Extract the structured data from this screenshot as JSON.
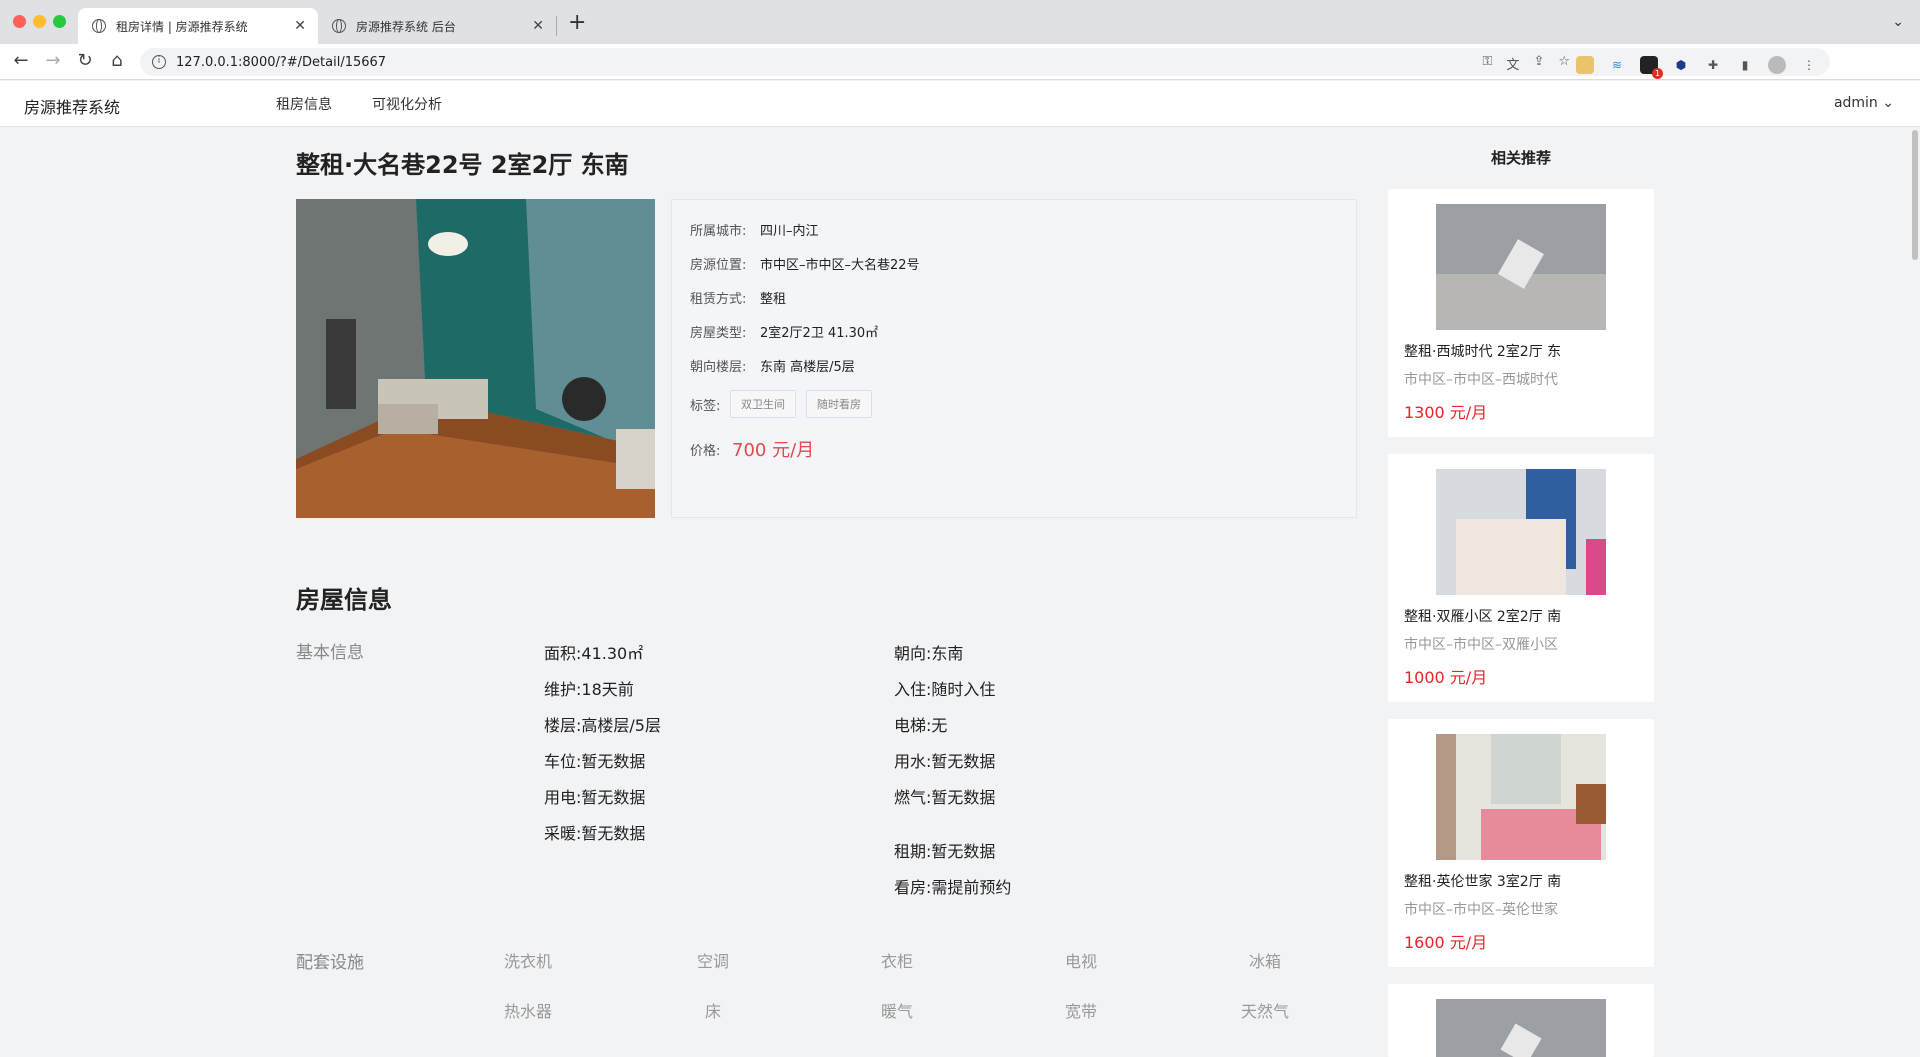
{
  "browser": {
    "tabs": [
      {
        "label": "租房详情 | 房源推荐系统",
        "close": "✕"
      },
      {
        "label": "房源推荐系统 后台",
        "close": "✕"
      }
    ],
    "new_tab": "+",
    "url": "127.0.0.1:8000/?#/Detail/15667",
    "ext_badge": "1"
  },
  "app": {
    "brand": "房源推荐系统",
    "menu": [
      "租房信息",
      "可视化分析"
    ],
    "user": "admin"
  },
  "house": {
    "title": "整租·大名巷22号 2室2厅 东南",
    "info": [
      {
        "k": "所属城市:",
        "v": "四川–内江"
      },
      {
        "k": "房源位置:",
        "v": "市中区–市中区–大名巷22号"
      },
      {
        "k": "租赁方式:",
        "v": "整租"
      },
      {
        "k": "房屋类型:",
        "v": "2室2厅2卫 41.30㎡"
      },
      {
        "k": "朝向楼层:",
        "v": "东南 高楼层/5层"
      }
    ],
    "tags_label": "标签:",
    "tags": [
      "双卫生间",
      "随时看房"
    ],
    "price_label": "价格:",
    "price": "700 元/月"
  },
  "details": {
    "heading": "房屋信息",
    "basic_label": "基本信息",
    "left": [
      {
        "k": "面积:",
        "v": "41.30㎡"
      },
      {
        "k": "维护:",
        "v": "18天前"
      },
      {
        "k": "楼层:",
        "v": "高楼层/5层"
      },
      {
        "k": "车位:",
        "v": "暂无数据"
      },
      {
        "k": "用电:",
        "v": "暂无数据"
      },
      {
        "k": "采暖:",
        "v": "暂无数据"
      }
    ],
    "right": [
      {
        "k": "朝向:",
        "v": "东南"
      },
      {
        "k": "入住:",
        "v": "随时入住"
      },
      {
        "k": "电梯:",
        "v": "无"
      },
      {
        "k": "用水:",
        "v": "暂无数据"
      },
      {
        "k": "燃气:",
        "v": "暂无数据"
      },
      {
        "k": "租期:",
        "v": "暂无数据"
      },
      {
        "k": "看房:",
        "v": "需提前预约"
      }
    ],
    "facilities_label": "配套设施",
    "facilities": [
      "洗衣机",
      "空调",
      "衣柜",
      "电视",
      "冰箱",
      "热水器",
      "床",
      "暖气",
      "宽带",
      "天然气"
    ]
  },
  "recommend": {
    "heading": "相关推荐",
    "items": [
      {
        "title": "整租·西城时代 2室2厅 东",
        "loc": "市中区–市中区–西城时代",
        "price": "1300 元/月"
      },
      {
        "title": "整租·双雁小区 2室2厅 南",
        "loc": "市中区–市中区–双雁小区",
        "price": "1000 元/月"
      },
      {
        "title": "整租·英伦世家 3室2厅 南",
        "loc": "市中区–市中区–英伦世家",
        "price": "1600 元/月"
      }
    ]
  }
}
